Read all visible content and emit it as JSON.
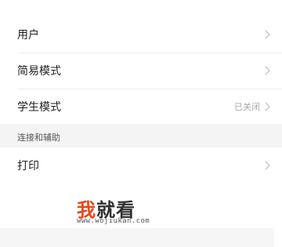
{
  "settings": {
    "items": [
      {
        "label": "用户",
        "value": ""
      },
      {
        "label": "简易模式",
        "value": ""
      },
      {
        "label": "学生模式",
        "value": "已关闭"
      }
    ],
    "section": {
      "title": "连接和辅助",
      "items": [
        {
          "label": "打印",
          "value": ""
        }
      ]
    }
  },
  "watermark": {
    "brand_accent": "我",
    "brand_rest": "就看",
    "url": "www.wojiukan.com"
  },
  "colors": {
    "accent": "#e8471c",
    "text": "#1f1f1f",
    "secondary": "#a8a8a8",
    "section_bg": "#f4f4f4"
  },
  "icons": {
    "row_arrow": "chevron-right-icon"
  }
}
